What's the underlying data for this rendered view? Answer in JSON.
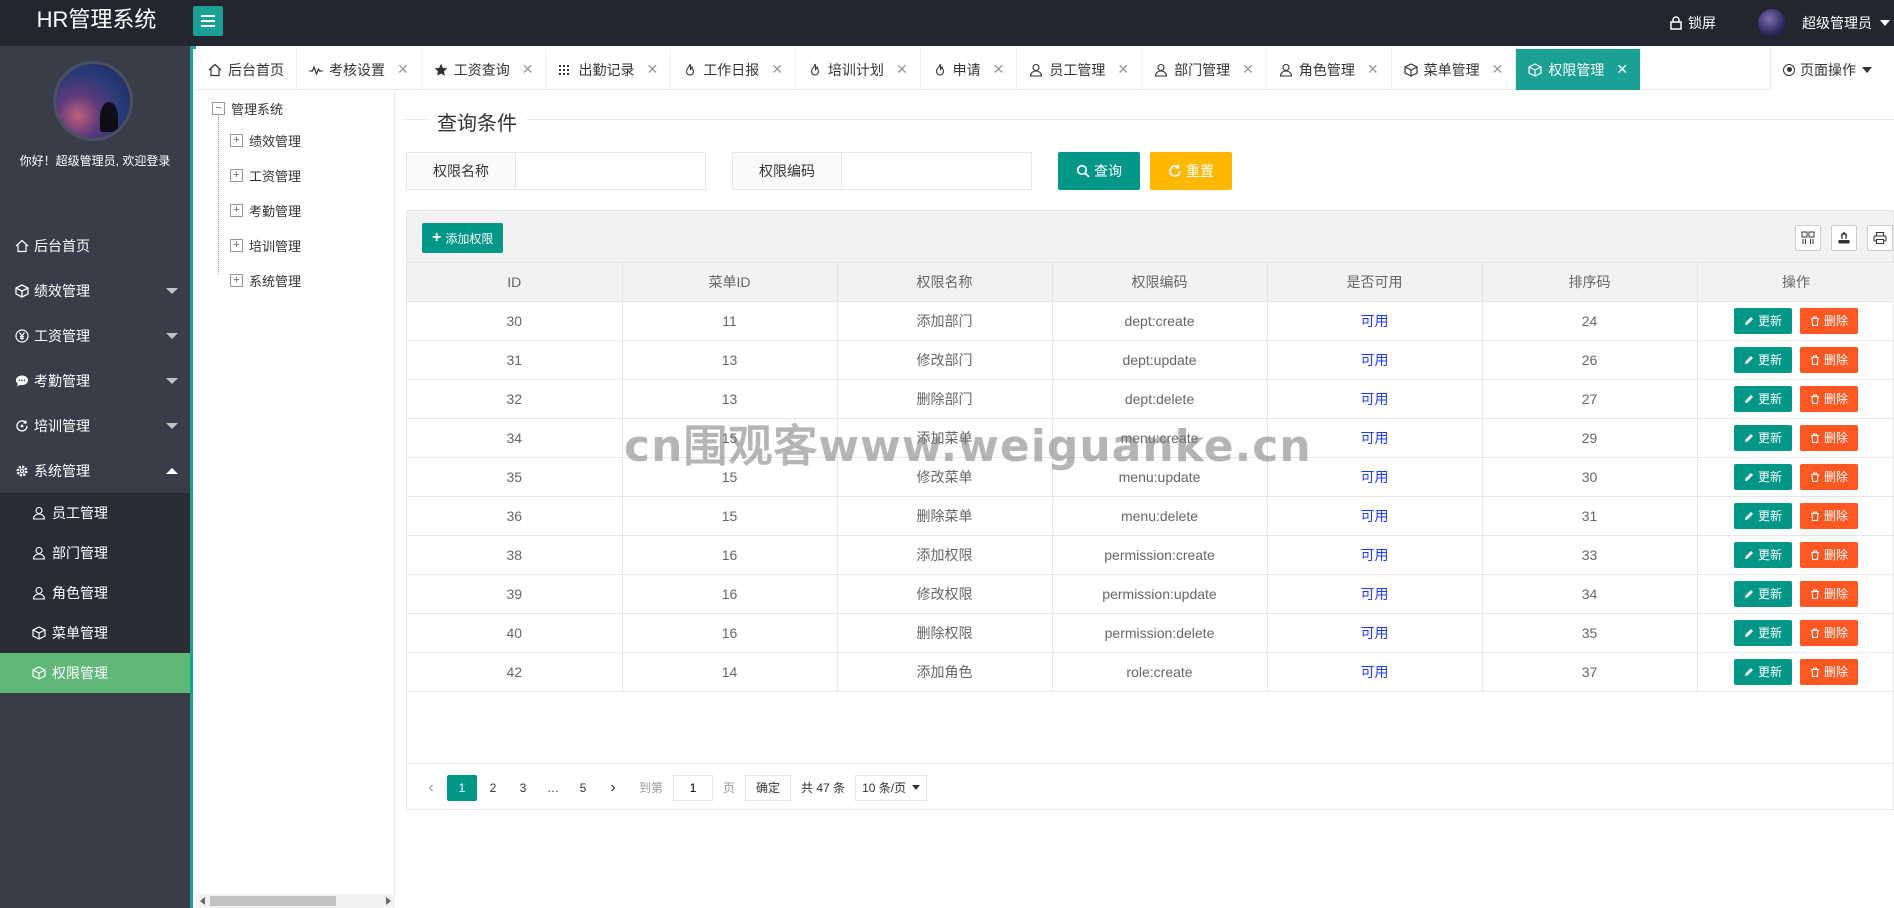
{
  "header": {
    "app_title": "HR管理系统",
    "lock_label": "锁屏",
    "user_name": "超级管理员"
  },
  "sidebar": {
    "welcome": "你好！超级管理员, 欢迎登录",
    "items": [
      {
        "label": "后台首页",
        "icon": "home-icon"
      },
      {
        "label": "绩效管理",
        "icon": "cube-icon"
      },
      {
        "label": "工资管理",
        "icon": "yen-icon"
      },
      {
        "label": "考勤管理",
        "icon": "chat-icon"
      },
      {
        "label": "培训管理",
        "icon": "refresh-icon"
      },
      {
        "label": "系统管理",
        "icon": "gear-icon"
      }
    ],
    "sub_items": [
      {
        "label": "员工管理",
        "icon": "user-icon"
      },
      {
        "label": "部门管理",
        "icon": "user-icon"
      },
      {
        "label": "角色管理",
        "icon": "user-icon"
      },
      {
        "label": "菜单管理",
        "icon": "cube-icon"
      },
      {
        "label": "权限管理",
        "icon": "cube-icon"
      }
    ]
  },
  "tabs": [
    {
      "label": "后台首页",
      "icon": "home-icon",
      "closable": false
    },
    {
      "label": "考核设置",
      "icon": "pulse-icon",
      "closable": true
    },
    {
      "label": "工资查询",
      "icon": "star-icon",
      "closable": true
    },
    {
      "label": "出勤记录",
      "icon": "grid-icon",
      "closable": true
    },
    {
      "label": "工作日报",
      "icon": "fire-icon",
      "closable": true
    },
    {
      "label": "培训计划",
      "icon": "fire-icon",
      "closable": true
    },
    {
      "label": "申请",
      "icon": "fire-icon",
      "closable": true
    },
    {
      "label": "员工管理",
      "icon": "user-icon",
      "closable": true
    },
    {
      "label": "部门管理",
      "icon": "user-icon",
      "closable": true
    },
    {
      "label": "角色管理",
      "icon": "user-icon",
      "closable": true
    },
    {
      "label": "菜单管理",
      "icon": "cube-icon",
      "closable": true
    },
    {
      "label": "权限管理",
      "icon": "cube-icon",
      "closable": true
    }
  ],
  "page_ops_label": "页面操作",
  "tree": {
    "root": "管理系统",
    "children": [
      "绩效管理",
      "工资管理",
      "考勤管理",
      "培训管理",
      "系统管理"
    ]
  },
  "query": {
    "legend": "查询条件",
    "field1_label": "权限名称",
    "field1_value": "",
    "field2_label": "权限编码",
    "field2_value": "",
    "search_label": "查询",
    "reset_label": "重置"
  },
  "toolbar": {
    "add_label": "添加权限"
  },
  "table": {
    "columns": [
      "ID",
      "菜单ID",
      "权限名称",
      "权限编码",
      "是否可用",
      "排序码",
      "操作"
    ],
    "edit_label": "更新",
    "delete_label": "删除",
    "rows": [
      [
        "30",
        "11",
        "添加部门",
        "dept:create",
        "可用",
        "24"
      ],
      [
        "31",
        "13",
        "修改部门",
        "dept:update",
        "可用",
        "26"
      ],
      [
        "32",
        "13",
        "删除部门",
        "dept:delete",
        "可用",
        "27"
      ],
      [
        "34",
        "15",
        "添加菜单",
        "menu:create",
        "可用",
        "29"
      ],
      [
        "35",
        "15",
        "修改菜单",
        "menu:update",
        "可用",
        "30"
      ],
      [
        "36",
        "15",
        "删除菜单",
        "menu:delete",
        "可用",
        "31"
      ],
      [
        "38",
        "16",
        "添加权限",
        "permission:create",
        "可用",
        "33"
      ],
      [
        "39",
        "16",
        "修改权限",
        "permission:update",
        "可用",
        "34"
      ],
      [
        "40",
        "16",
        "删除权限",
        "permission:delete",
        "可用",
        "35"
      ],
      [
        "42",
        "14",
        "添加角色",
        "role:create",
        "可用",
        "37"
      ]
    ]
  },
  "pager": {
    "pages": [
      "1",
      "2",
      "3",
      "…",
      "5"
    ],
    "current": "1",
    "goto_label": "到第",
    "goto_value": "1",
    "page_unit": "页",
    "confirm_label": "确定",
    "total": "共 47 条",
    "page_size": "10 条/页"
  },
  "watermark": "cn围观客www.weiguanke.cn",
  "colors": {
    "accent": "#1aa094",
    "primary_btn": "#009688",
    "warn_btn": "#ffb800",
    "danger_btn": "#ff5722",
    "sidebar_bg": "#393d49",
    "active_nav": "#5fb878",
    "status_blue": "#1e3cfd"
  }
}
